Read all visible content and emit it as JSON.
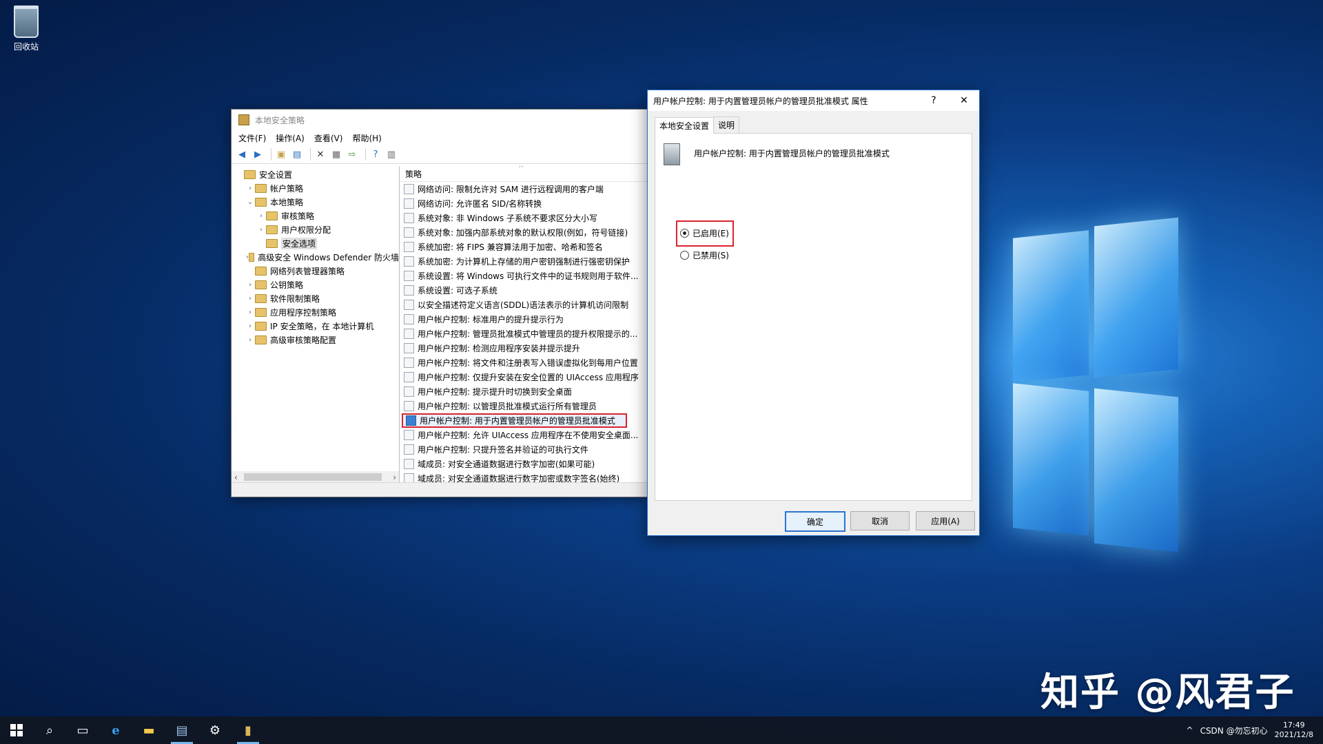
{
  "desktop": {
    "recycle_bin": "回收站",
    "watermark": "知乎 @风君子"
  },
  "mmc": {
    "title": "本地安全策略",
    "menu": [
      "文件(F)",
      "操作(A)",
      "查看(V)",
      "帮助(H)"
    ],
    "tree": [
      {
        "label": "安全设置",
        "level": 0,
        "caret": ""
      },
      {
        "label": "帐户策略",
        "level": 1,
        "caret": ">"
      },
      {
        "label": "本地策略",
        "level": 1,
        "caret": "v"
      },
      {
        "label": "审核策略",
        "level": 2,
        "caret": ">"
      },
      {
        "label": "用户权限分配",
        "level": 2,
        "caret": ">"
      },
      {
        "label": "安全选项",
        "level": 2,
        "caret": "",
        "selected": true
      },
      {
        "label": "高级安全 Windows Defender 防火墙",
        "level": 1,
        "caret": ">"
      },
      {
        "label": "网络列表管理器策略",
        "level": 1,
        "caret": ""
      },
      {
        "label": "公钥策略",
        "level": 1,
        "caret": ">"
      },
      {
        "label": "软件限制策略",
        "level": 1,
        "caret": ">"
      },
      {
        "label": "应用程序控制策略",
        "level": 1,
        "caret": ">"
      },
      {
        "label": "IP 安全策略，在 本地计算机",
        "level": 1,
        "caret": ">"
      },
      {
        "label": "高级审核策略配置",
        "level": 1,
        "caret": ">"
      }
    ],
    "list_header": "策略",
    "policies": [
      "网络访问: 限制允许对 SAM 进行远程调用的客户端",
      "网络访问: 允许匿名 SID/名称转换",
      "系统对象: 非 Windows 子系统不要求区分大小写",
      "系统对象: 加强内部系统对象的默认权限(例如，符号链接)",
      "系统加密: 将 FIPS 兼容算法用于加密、哈希和签名",
      "系统加密: 为计算机上存储的用户密钥强制进行强密钥保护",
      "系统设置: 将 Windows 可执行文件中的证书规则用于软件...",
      "系统设置: 可选子系统",
      "以安全描述符定义语言(SDDL)语法表示的计算机访问限制",
      "用户帐户控制: 标准用户的提升提示行为",
      "用户帐户控制: 管理员批准模式中管理员的提升权限提示的...",
      "用户帐户控制: 检测应用程序安装并提示提升",
      "用户帐户控制: 将文件和注册表写入错误虚拟化到每用户位置",
      "用户帐户控制: 仅提升安装在安全位置的 UIAccess 应用程序",
      "用户帐户控制: 提示提升时切换到安全桌面",
      "用户帐户控制: 以管理员批准模式运行所有管理员",
      "用户帐户控制: 用于内置管理员帐户的管理员批准模式",
      "用户帐户控制: 允许 UIAccess 应用程序在不使用安全桌面...",
      "用户帐户控制: 只提升签名并验证的可执行文件",
      "域成员: 对安全通道数据进行数字加密(如果可能)",
      "域成员: 对安全通道数据进行数字加密或数字签名(始终)"
    ],
    "selected_policy_index": 16
  },
  "dialog": {
    "title": "用户帐户控制: 用于内置管理员帐户的管理员批准模式 属性",
    "help": "?",
    "close": "✕",
    "tabs": [
      "本地安全设置",
      "说明"
    ],
    "policy_name": "用户帐户控制: 用于内置管理员帐户的管理员批准模式",
    "enabled_label": "已启用(E)",
    "disabled_label": "已禁用(S)",
    "selected": "enabled",
    "buttons": {
      "ok": "确定",
      "cancel": "取消",
      "apply": "应用(A)"
    }
  },
  "taskbar": {
    "tray_text": "CSDN @勿忘初心",
    "time": "17:49",
    "date": "2021/12/8"
  }
}
